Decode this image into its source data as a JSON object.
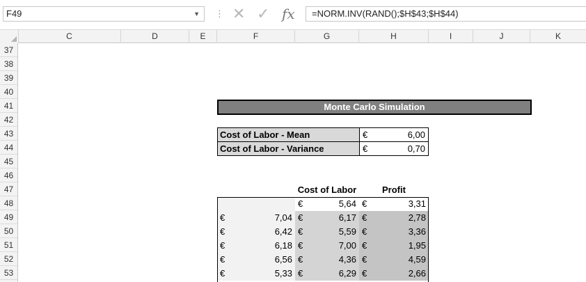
{
  "formula_bar": {
    "name_box": "F49",
    "formula": "=NORM.INV(RAND();$H$43;$H$44)",
    "separator": "⋮",
    "cancel_glyph": "✕",
    "enter_glyph": "✓",
    "fx_glyph": "fx",
    "dropdown_glyph": "▼",
    "icons": [
      "cancel-icon",
      "enter-icon",
      "function-icon"
    ]
  },
  "columns": [
    "C",
    "D",
    "E",
    "F",
    "G",
    "H",
    "I",
    "J",
    "K"
  ],
  "rows": [
    "37",
    "38",
    "39",
    "40",
    "41",
    "42",
    "43",
    "44",
    "45",
    "46",
    "47",
    "48",
    "49",
    "50",
    "51",
    "52",
    "53"
  ],
  "sheet": {
    "title": "Monte Carlo Simulation",
    "params": [
      {
        "label": "Cost of Labor - Mean",
        "currency": "€",
        "value": "6,00"
      },
      {
        "label": "Cost of Labor - Variance",
        "currency": "€",
        "value": "0,70"
      }
    ],
    "table_headers": {
      "g": "Cost of Labor",
      "h": "Profit"
    },
    "table_rows": [
      {
        "f_cur": "",
        "f": "",
        "g_cur": "€",
        "g": "5,64",
        "h_cur": "€",
        "h": "3,31"
      },
      {
        "f_cur": "€",
        "f": "7,04",
        "g_cur": "€",
        "g": "6,17",
        "h_cur": "€",
        "h": "2,78"
      },
      {
        "f_cur": "€",
        "f": "6,42",
        "g_cur": "€",
        "g": "5,59",
        "h_cur": "€",
        "h": "3,36"
      },
      {
        "f_cur": "€",
        "f": "6,18",
        "g_cur": "€",
        "g": "7,00",
        "h_cur": "€",
        "h": "1,95"
      },
      {
        "f_cur": "€",
        "f": "6,56",
        "g_cur": "€",
        "g": "4,36",
        "h_cur": "€",
        "h": "4,59"
      },
      {
        "f_cur": "€",
        "f": "5,33",
        "g_cur": "€",
        "g": "6,29",
        "h_cur": "€",
        "h": "2,66"
      }
    ]
  }
}
